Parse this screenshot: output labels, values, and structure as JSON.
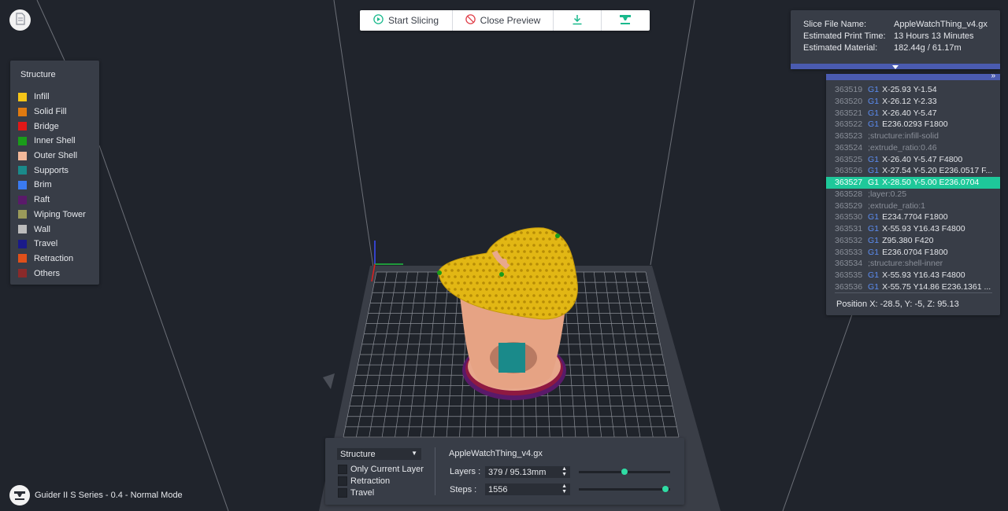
{
  "toolbar": {
    "start_slicing": "Start Slicing",
    "close_preview": "Close Preview"
  },
  "legend": {
    "title": "Structure",
    "items": [
      {
        "label": "Infill",
        "color": "#f5c518"
      },
      {
        "label": "Solid Fill",
        "color": "#e07a10"
      },
      {
        "label": "Bridge",
        "color": "#e01818"
      },
      {
        "label": "Inner Shell",
        "color": "#1a9c1a"
      },
      {
        "label": "Outer Shell",
        "color": "#f2b89a"
      },
      {
        "label": "Supports",
        "color": "#1a8a8a"
      },
      {
        "label": "Brim",
        "color": "#3a7af0"
      },
      {
        "label": "Raft",
        "color": "#5a1a6a"
      },
      {
        "label": "Wiping Tower",
        "color": "#9a9a5a"
      },
      {
        "label": "Wall",
        "color": "#bcbcbc"
      },
      {
        "label": "Travel",
        "color": "#1a1a8a"
      },
      {
        "label": "Retraction",
        "color": "#e0501a"
      },
      {
        "label": "Others",
        "color": "#8a2a2a"
      }
    ]
  },
  "info": {
    "file_name_label": "Slice File Name:",
    "file_name_value": "AppleWatchThing_v4.gx",
    "print_time_label": "Estimated Print Time:",
    "print_time_value": "13 Hours 13 Minutes",
    "material_label": "Estimated Material:",
    "material_value": "182.44g / 61.17m"
  },
  "gcode": {
    "lines": [
      {
        "num": "363519",
        "cmd": "G1",
        "args": "X-25.93 Y-1.54"
      },
      {
        "num": "363520",
        "cmd": "G1",
        "args": "X-26.12 Y-2.33"
      },
      {
        "num": "363521",
        "cmd": "G1",
        "args": "X-26.40 Y-5.47"
      },
      {
        "num": "363522",
        "cmd": "G1",
        "args": "E236.0293 F1800"
      },
      {
        "num": "363523",
        "cmd": "",
        "args": ";structure:infill-solid"
      },
      {
        "num": "363524",
        "cmd": "",
        "args": ";extrude_ratio:0.46"
      },
      {
        "num": "363525",
        "cmd": "G1",
        "args": "X-26.40 Y-5.47 F4800"
      },
      {
        "num": "363526",
        "cmd": "G1",
        "args": "X-27.54 Y-5.20 E236.0517 F..."
      },
      {
        "num": "363527",
        "cmd": "G1",
        "args": "X-28.50 Y-5.00 E236.0704",
        "active": true
      },
      {
        "num": "363528",
        "cmd": "",
        "args": ";layer:0.25"
      },
      {
        "num": "363529",
        "cmd": "",
        "args": ";extrude_ratio:1"
      },
      {
        "num": "363530",
        "cmd": "G1",
        "args": "E234.7704 F1800"
      },
      {
        "num": "363531",
        "cmd": "G1",
        "args": "X-55.93 Y16.43 F4800"
      },
      {
        "num": "363532",
        "cmd": "G1",
        "args": "Z95.380 F420"
      },
      {
        "num": "363533",
        "cmd": "G1",
        "args": "E236.0704 F1800"
      },
      {
        "num": "363534",
        "cmd": "",
        "args": ";structure:shell-inner"
      },
      {
        "num": "363535",
        "cmd": "G1",
        "args": "X-55.93 Y16.43 F4800"
      },
      {
        "num": "363536",
        "cmd": "G1",
        "args": "X-55.75 Y14.86 E236.1361 ..."
      }
    ],
    "position": "Position   X: -28.5, Y: -5, Z: 95.13"
  },
  "preview": {
    "view_select": "Structure",
    "only_current_layer": "Only Current Layer",
    "retraction": "Retraction",
    "travel": "Travel",
    "file_name": "AppleWatchThing_v4.gx",
    "layers_label": "Layers :",
    "layers_value": "379 / 95.13mm",
    "layers_slider_fraction": 0.5,
    "steps_label": "Steps :",
    "steps_value": "1556",
    "steps_slider_fraction": 0.95
  },
  "footer": {
    "printer": "Guider II S Series - 0.4 - Normal Mode"
  },
  "colors": {
    "accent": "#1ec89a",
    "panel": "#383d47",
    "background": "#20242c",
    "blue_bar": "#4a5bb0"
  }
}
